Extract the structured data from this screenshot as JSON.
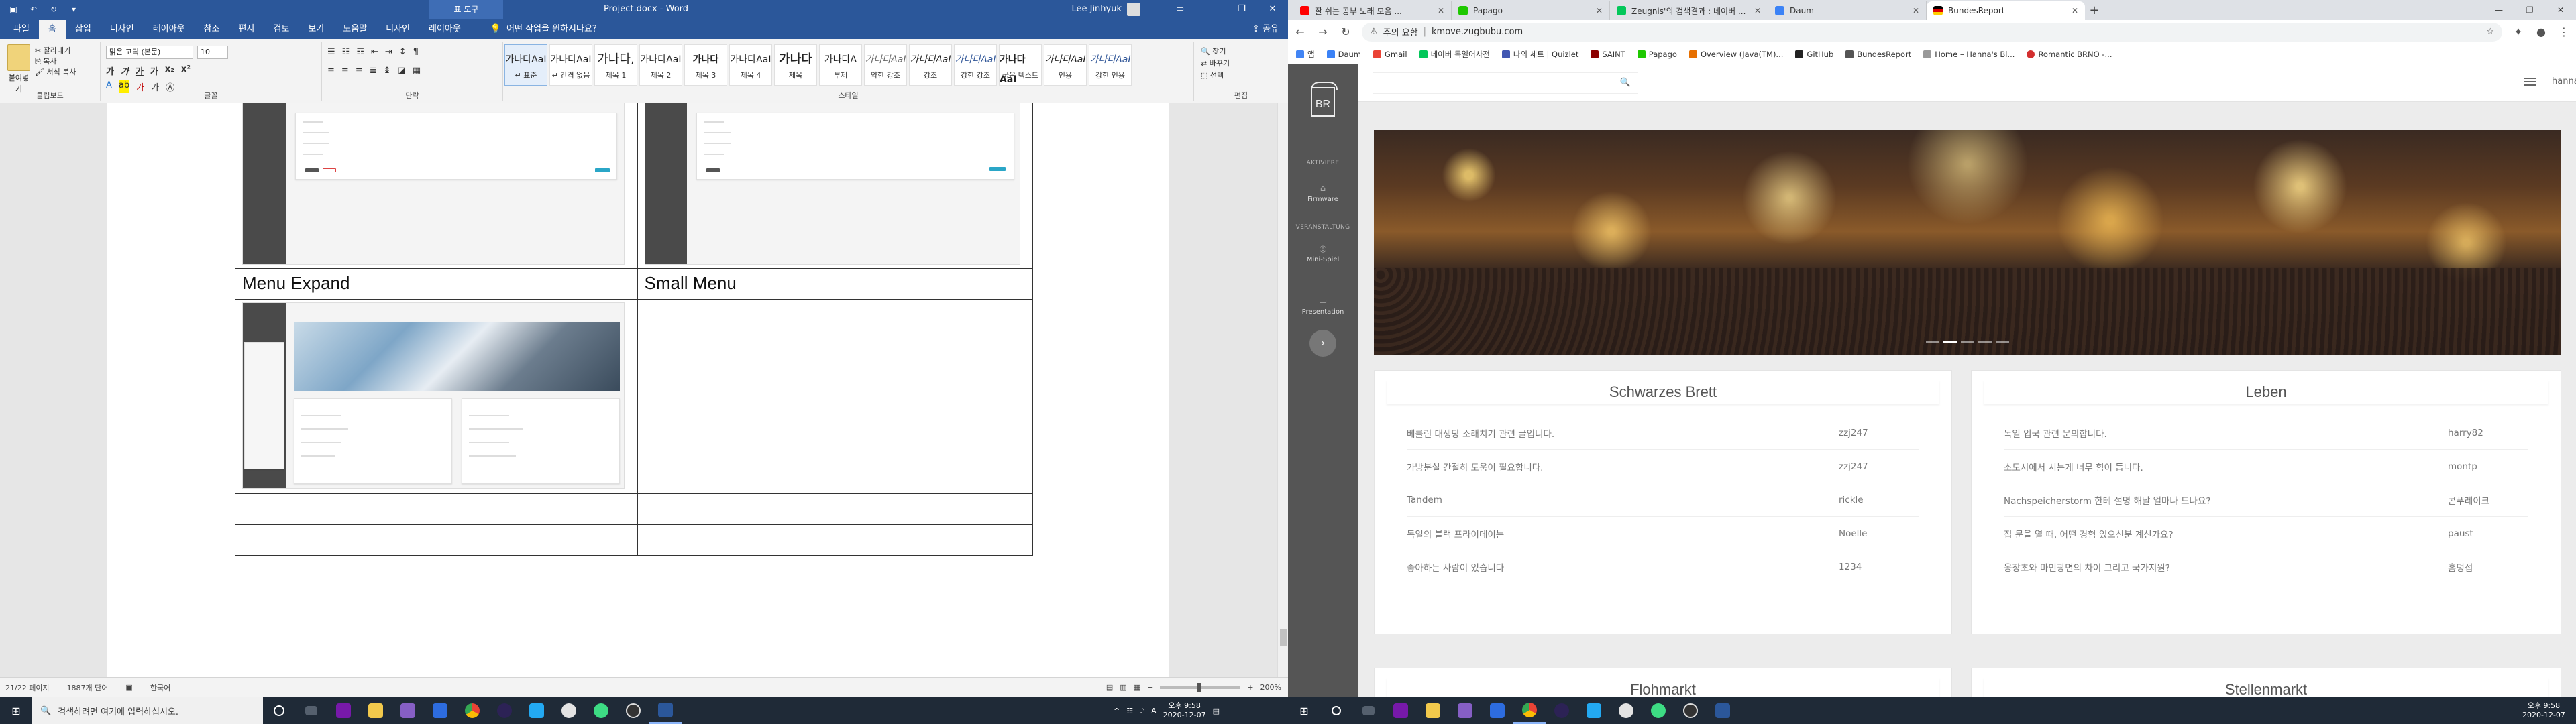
{
  "word": {
    "title_context": "표 도구",
    "doc_title": "Project.docx  -  Word",
    "user_name": "Lee Jinhyuk",
    "tabs": [
      "파일",
      "홈",
      "삽입",
      "디자인",
      "레이아웃",
      "참조",
      "편지",
      "검토",
      "보기",
      "도움말",
      "디자인",
      "레이아웃"
    ],
    "tell_me": "어떤 작업을 원하시나요?",
    "share": "공유",
    "clipboard": {
      "paste": "붙여넣기",
      "cut": "잘라내기",
      "copy": "복사",
      "format": "서식 복사",
      "label": "클립보드"
    },
    "font": {
      "name": "맑은 고딕 (본문)",
      "size": "10",
      "label": "글꼴"
    },
    "paragraph_label": "단락",
    "styles_label": "스타일",
    "styles": [
      {
        "preview": "가나다AaI",
        "name": "↵ 표준"
      },
      {
        "preview": "가나다AaI",
        "name": "↵ 간격 없음"
      },
      {
        "preview": "가나다,",
        "name": "제목 1"
      },
      {
        "preview": "가나다AaI",
        "name": "제목 2"
      },
      {
        "preview": "가나다",
        "name": "제목 3"
      },
      {
        "preview": "가나다AaI",
        "name": "제목 4"
      },
      {
        "preview": "가나다",
        "name": "제목"
      },
      {
        "preview": "가나다A",
        "name": "부제"
      },
      {
        "preview": "가나다AaI",
        "name": "약한 강조"
      },
      {
        "preview": "가나다AaI",
        "name": "강조"
      },
      {
        "preview": "가나다AaI",
        "name": "강한 강조"
      },
      {
        "preview": "가나다AaI",
        "name": "굵은 텍스트"
      },
      {
        "preview": "가나다AaI",
        "name": "인용"
      },
      {
        "preview": "가나다AaI",
        "name": "강한 인용"
      }
    ],
    "editing": {
      "find": "찾기",
      "replace": "바꾸기",
      "select": "선택",
      "label": "편집"
    },
    "table_labels": {
      "menu_expand": "Menu Expand",
      "small_menu": "Small Menu"
    },
    "status": {
      "page": "21/22 페이지",
      "words": "1887개 단어",
      "lang": "한국어",
      "zoom": "200%"
    }
  },
  "chrome": {
    "tabs": [
      {
        "title": "잘 쉬는 공부 노래 모음 ...",
        "color": "#ff0000"
      },
      {
        "title": "Papago",
        "color": "#1ec800"
      },
      {
        "title": "Zeugnis'의 검색결과 : 네이버 ...",
        "color": "#03c75a"
      },
      {
        "title": "Daum",
        "color": "#3b82f6"
      },
      {
        "title": "BundesReport",
        "color": "#000000"
      }
    ],
    "active_tab": 4,
    "url_warning": "주의 요함",
    "url": "kmove.zugbubu.com",
    "bookmarks": [
      {
        "label": "앱",
        "color": "#4285f4"
      },
      {
        "label": "Daum",
        "color": "#3b82f6"
      },
      {
        "label": "Gmail",
        "color": "#ea4335"
      },
      {
        "label": "네이버 독일어사전",
        "color": "#03c75a"
      },
      {
        "label": "나의 세트 | Quizlet",
        "color": "#4257b2"
      },
      {
        "label": "SAINT",
        "color": "#8b0000"
      },
      {
        "label": "Papago",
        "color": "#1ec800"
      },
      {
        "label": "Overview (Java(TM)...",
        "color": "#e76f00"
      },
      {
        "label": "GitHub",
        "color": "#222222"
      },
      {
        "label": "BundesReport",
        "color": "#555555"
      },
      {
        "label": "Home – Hanna's Bl...",
        "color": "#999999"
      },
      {
        "label": "Romantic BRNO -...",
        "color": "#d32f2f"
      }
    ],
    "site": {
      "logo": "BR",
      "sidebar": {
        "section1": "AKTIVIERE",
        "item1": "Firmware",
        "section2": "VERANSTALTUNG",
        "item2": "Mini-Spiel",
        "item3": "Presentation"
      },
      "username": "hanna",
      "cards": [
        {
          "title": "Schwarzes Brett",
          "rows": [
            {
              "text": "베를린 대생당 소래치기 관련 글입니다.",
              "author": "zzj247"
            },
            {
              "text": "가방분실 간절히 도움이 필요합니다.",
              "author": "zzj247"
            },
            {
              "text": "Tandem",
              "author": "rickle"
            },
            {
              "text": "독일의 블랙 프라이데이는",
              "author": "Noelle"
            },
            {
              "text": "좋아하는 사람이 있습니다",
              "author": "1234"
            }
          ]
        },
        {
          "title": "Leben",
          "rows": [
            {
              "text": "독일 입국 관련 문의합니다.",
              "author": "harry82"
            },
            {
              "text": "소도시에서 시는게 너무 힘이 듭니다.",
              "author": "montp"
            },
            {
              "text": "Nachspeicherstorm 한테 설명 해달 얼마나 드나요?",
              "author": "콘푸레이크"
            },
            {
              "text": "집 문을 열 때, 어떤 경험 있으신분 계신가요?",
              "author": "paust"
            },
            {
              "text": "옹장초와 마인광면의 차이 그리고 국가지원?",
              "author": "홈덩접"
            }
          ]
        }
      ],
      "lower_cards": [
        "Flohmarkt",
        "Stellenmarkt"
      ]
    }
  },
  "taskbar": {
    "search_placeholder": "검색하려면 여기에 입력하십시오.",
    "left_time": "오후 9:58",
    "left_date": "2020-12-07",
    "right_time": "오후 9:58",
    "right_date": "2020-12-07"
  }
}
